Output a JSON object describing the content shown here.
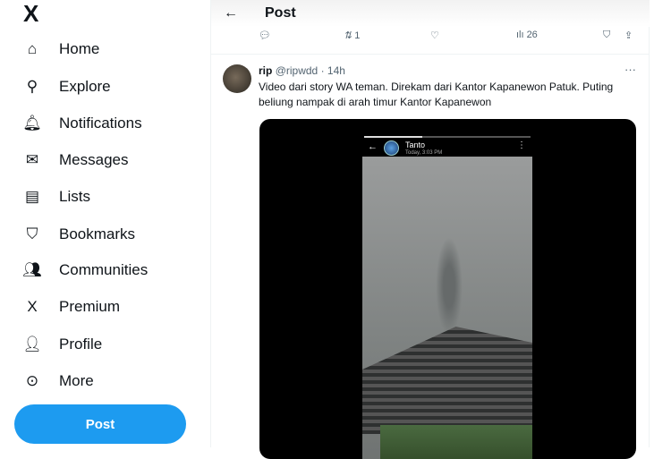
{
  "sidebar": {
    "logo": "X",
    "items": [
      {
        "label": "Home",
        "icon": "home-icon",
        "glyph": "⌂"
      },
      {
        "label": "Explore",
        "icon": "search-icon",
        "glyph": "⚲"
      },
      {
        "label": "Notifications",
        "icon": "bell-icon",
        "glyph": "🔔︎"
      },
      {
        "label": "Messages",
        "icon": "envelope-icon",
        "glyph": "✉"
      },
      {
        "label": "Lists",
        "icon": "list-icon",
        "glyph": "▤"
      },
      {
        "label": "Bookmarks",
        "icon": "bookmark-icon",
        "glyph": "⛉"
      },
      {
        "label": "Communities",
        "icon": "people-icon",
        "glyph": "👥︎"
      },
      {
        "label": "Premium",
        "icon": "x-icon",
        "glyph": "X"
      },
      {
        "label": "Profile",
        "icon": "person-icon",
        "glyph": "👤︎"
      },
      {
        "label": "More",
        "icon": "more-circle-icon",
        "glyph": "⊙"
      }
    ],
    "post_button": "Post"
  },
  "header": {
    "back": "←",
    "title": "Post"
  },
  "actions": {
    "reply": "",
    "retweet_count": "1",
    "like": "",
    "views": "26"
  },
  "tweet": {
    "name": "rip",
    "handle": "@ripwdd",
    "time": "14h",
    "separator": "·",
    "more": "···",
    "text": "Video dari story WA teman. Direkam dari Kantor Kapanewon Patuk. Puting beliung nampak di arah timur Kantor Kapanewon",
    "story": {
      "name": "Tanto",
      "time": "Today, 3:03 PM"
    }
  },
  "colors": {
    "accent": "#1d9bf0"
  }
}
